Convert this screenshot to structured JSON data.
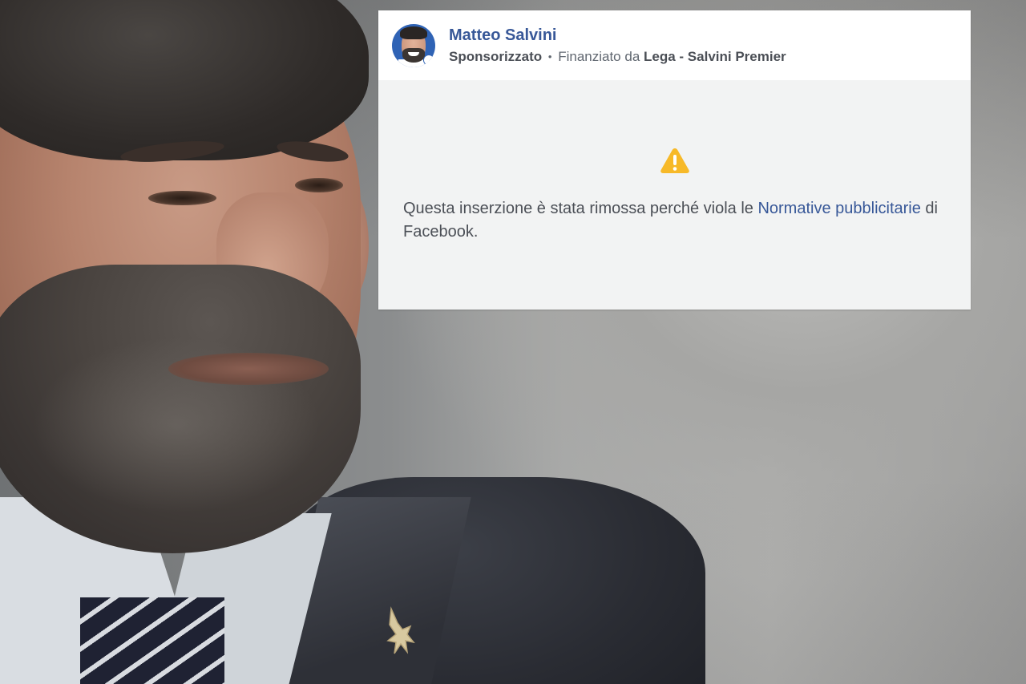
{
  "background": {
    "description_icon": "portrait-photo"
  },
  "post": {
    "author": "Matteo Salvini",
    "sponsored_label": "Sponsorizzato",
    "separator": "•",
    "funded_prefix": "Finanziato da",
    "funded_by": "Lega - Salvini Premier",
    "notice_icon": "warning-triangle-icon",
    "notice_text_before": "Questa inserzione è stata rimossa perché viola le ",
    "notice_link": "Normative pubblicitarie",
    "notice_text_after": " di Facebook."
  },
  "colors": {
    "link_blue": "#385898",
    "warning_yellow": "#f7b928",
    "card_background": "#f2f3f3",
    "header_background": "#ffffff"
  }
}
